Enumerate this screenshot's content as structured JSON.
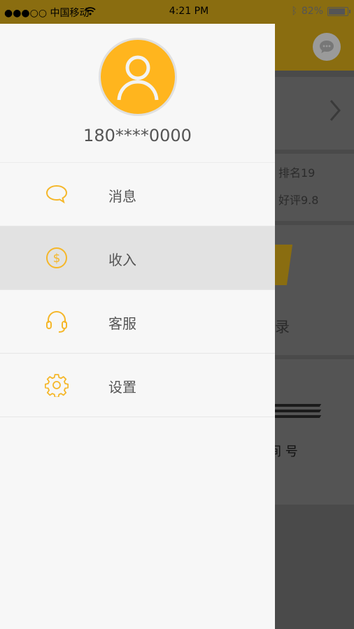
{
  "status_bar": {
    "carrier": "●●●○○ 中国移动",
    "time": "4:21 PM",
    "battery": "82%"
  },
  "background": {
    "rank": "排名19",
    "rating": "好评9.8",
    "record_partial": "录",
    "partial_text": "间 号"
  },
  "profile": {
    "phone": "180****0000"
  },
  "menu": {
    "items": [
      {
        "label": "消息",
        "icon": "chat-bubble-icon",
        "active": false
      },
      {
        "label": "收入",
        "icon": "dollar-coin-icon",
        "active": true
      },
      {
        "label": "客服",
        "icon": "headset-icon",
        "active": false
      },
      {
        "label": "设置",
        "icon": "gear-icon",
        "active": false
      }
    ]
  },
  "colors": {
    "accent": "#ffb51e",
    "drawer_bg": "#f7f7f7",
    "active_bg": "#e2e2e2"
  }
}
